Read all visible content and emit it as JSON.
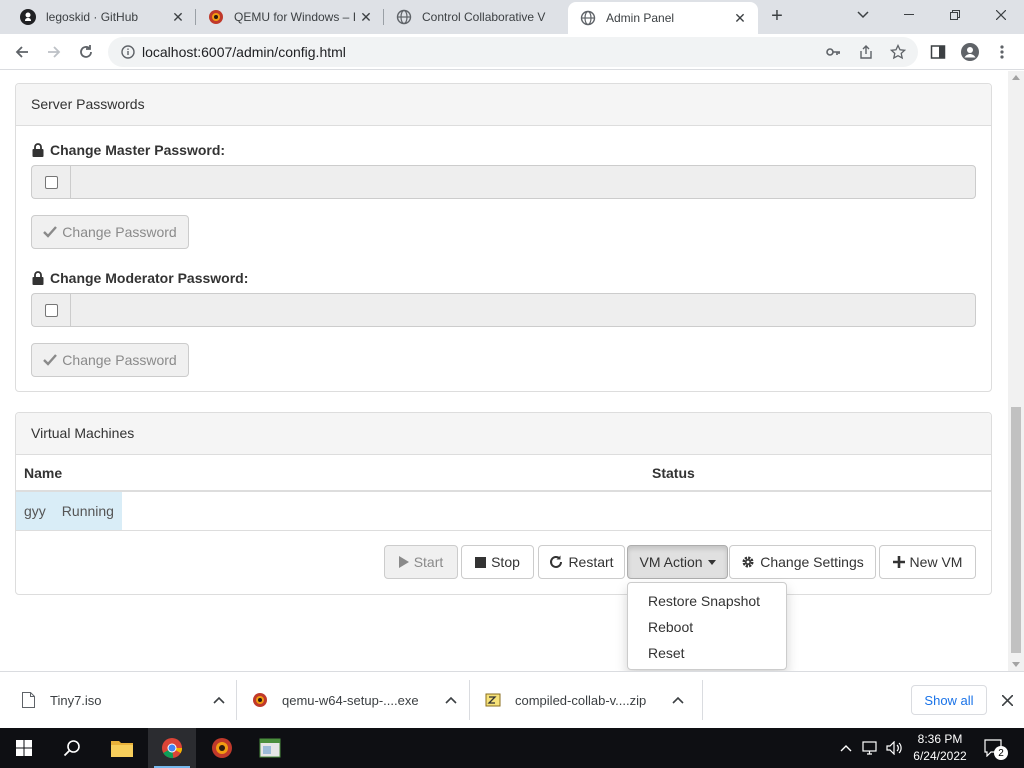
{
  "browser": {
    "tabs": [
      {
        "title": "legoskid · GitHub",
        "icon": "github-icon"
      },
      {
        "title": "QEMU for Windows – I",
        "icon": "qemu-icon"
      },
      {
        "title": "Control Collaborative V",
        "icon": "globe-icon"
      },
      {
        "title": "Admin Panel",
        "icon": "globe-icon",
        "active": true
      }
    ],
    "url": "localhost:6007/admin/config.html"
  },
  "server_passwords": {
    "heading": "Server Passwords",
    "master_label": "Change Master Password:",
    "moderator_label": "Change Moderator Password:",
    "change_button": "Change Password"
  },
  "virtual_machines": {
    "heading": "Virtual Machines",
    "columns": [
      "Name",
      "Status"
    ],
    "rows": [
      {
        "name": "gyy",
        "status": "Running"
      }
    ],
    "buttons": {
      "start": "Start",
      "stop": "Stop",
      "restart": "Restart",
      "vm_action": "VM Action",
      "change_settings": "Change Settings",
      "new_vm": "New VM"
    },
    "vm_action_menu": [
      "Restore Snapshot",
      "Reboot",
      "Reset"
    ]
  },
  "downloads": {
    "items": [
      {
        "name": "Tiny7.iso",
        "icon": "file-icon"
      },
      {
        "name": "qemu-w64-setup-....exe",
        "icon": "qemu-icon"
      },
      {
        "name": "compiled-collab-v....zip",
        "icon": "zip-icon"
      }
    ],
    "show_all": "Show all"
  },
  "taskbar": {
    "time": "8:36 PM",
    "date": "6/24/2022",
    "notification_count": "2"
  },
  "colors": {
    "selected_row": "#d9edf7",
    "link_blue": "#1a73e8",
    "taskbar": "#0e0f13"
  }
}
